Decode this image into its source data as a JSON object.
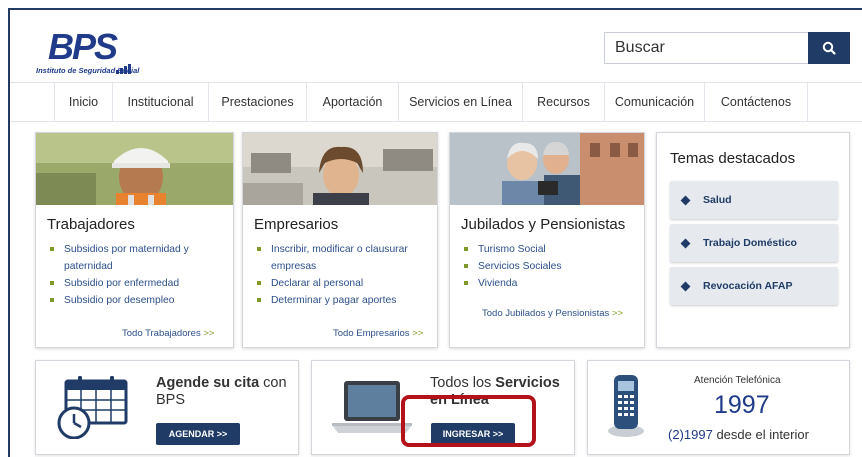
{
  "header": {
    "logo_mark": "BPS",
    "logo_subtitle": "Instituto de Seguridad Social",
    "search_placeholder": "Buscar"
  },
  "nav": {
    "items": [
      "Inicio",
      "Institucional",
      "Prestaciones",
      "Aportación",
      "Servicios en Línea",
      "Recursos",
      "Comunicación",
      "Contáctenos"
    ]
  },
  "cards": [
    {
      "title": "Trabajadores",
      "items": [
        "Subsidios por maternidad y paternidad",
        "Subsidio por enfermedad",
        "Subsidio por desempleo"
      ],
      "more": "Todo Trabajadores",
      "more_arrow": ">>"
    },
    {
      "title": "Empresarios",
      "items": [
        "Inscribir, modificar o clausurar empresas",
        "Declarar al personal",
        "Determinar y pagar aportes"
      ],
      "more": "Todo Empresarios",
      "more_arrow": ">>"
    },
    {
      "title": "Jubilados y Pensionistas",
      "items": [
        "Turismo Social",
        "Servicios Sociales",
        "Vivienda"
      ],
      "more": "Todo Jubilados y Pensionistas",
      "more_arrow": ">>"
    }
  ],
  "temas": {
    "title": "Temas destacados",
    "items": [
      "Salud",
      "Trabajo Doméstico",
      "Revocación AFAP"
    ]
  },
  "bottom": {
    "agenda": {
      "title_bold": "Agende su cita",
      "title_rest": "con",
      "line2": "BPS",
      "button": "AGENDAR >>"
    },
    "servicios": {
      "title_pre": "Todos los",
      "title_bold": "Servicios",
      "line2": "en Línea",
      "button": "INGRESAR >>"
    },
    "atencion": {
      "label": "Atención Telefónica",
      "number": "1997",
      "interior_code": "(2)1997",
      "interior_text": "desde el interior"
    }
  },
  "colors": {
    "brand": "#1f3b66",
    "accent_green": "#7f9a2a",
    "highlight_red": "#b3121b",
    "link": "#2c4f8a"
  }
}
